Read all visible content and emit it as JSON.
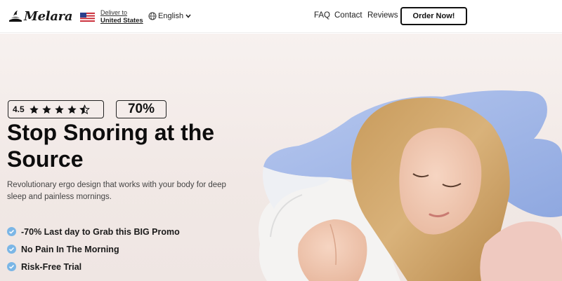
{
  "header": {
    "logo_text": "Melara",
    "deliver_label": "Deliver to",
    "deliver_country": "United States",
    "language": "English",
    "nav": [
      "FAQ",
      "Contact",
      "Reviews"
    ],
    "order_button": "Order Now!"
  },
  "hero": {
    "rating": "4.5",
    "rating_value": 4.5,
    "rating_max": 5,
    "discount": "70%",
    "headline": "Stop Snoring at the Source",
    "subtext": "Revolutionary ergo design that works with your body for deep sleep and painless mornings.",
    "features": [
      "-70% Last day to Grab this BIG Promo",
      "No Pain In The Morning",
      "Risk-Free Trial"
    ]
  },
  "colors": {
    "accent_check": "#7bb6e6",
    "pillow_blue": "#9fb5e6",
    "hero_bg": "#f3ebe8"
  }
}
